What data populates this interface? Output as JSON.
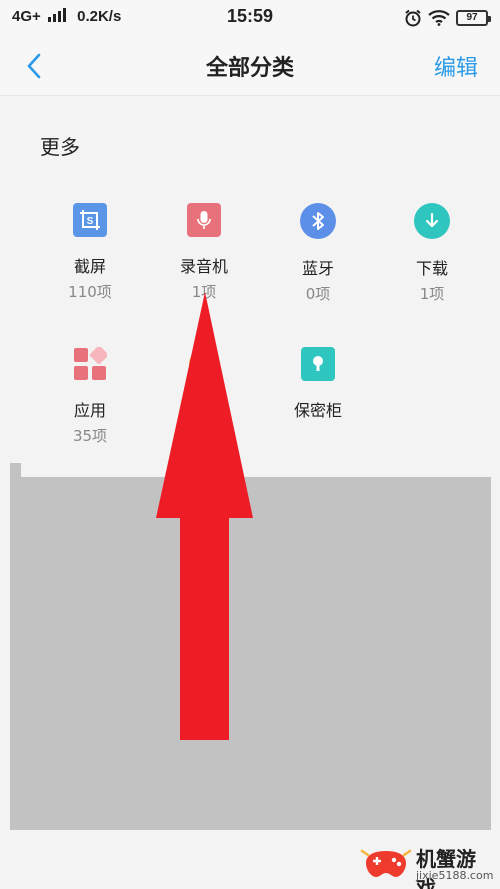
{
  "status_bar": {
    "network": "4G+",
    "speed": "0.2K/s",
    "time": "15:59",
    "battery": "97"
  },
  "nav": {
    "title": "全部分类",
    "edit_label": "编辑"
  },
  "section_title": "更多",
  "items": [
    {
      "name": "截屏",
      "count": "110项",
      "color": "#5b95e8",
      "icon": "screenshot-icon"
    },
    {
      "name": "录音机",
      "count": "1项",
      "color": "#e8727c",
      "icon": "microphone-icon"
    },
    {
      "name": "蓝牙",
      "count": "0项",
      "color": "#5b8fe8",
      "icon": "bluetooth-icon"
    },
    {
      "name": "下载",
      "count": "1项",
      "color": "#2fc6c0",
      "icon": "download-icon"
    },
    {
      "name": "应用",
      "count": "35项",
      "color": "#e8727c",
      "icon": "apps-icon"
    },
    {
      "name": "",
      "count": "",
      "color": "#f5b53d",
      "icon": "partially-hidden-icon"
    },
    {
      "name": "保密柜",
      "count": "",
      "color": "#2fc6c0",
      "icon": "safe-icon"
    }
  ],
  "watermark": {
    "brand": "机蟹游戏",
    "url": "jixie5188.com"
  },
  "colors": {
    "accent": "#2b9ae8",
    "arrow": "#ee1c25",
    "overlay": "#c2c2c2"
  }
}
